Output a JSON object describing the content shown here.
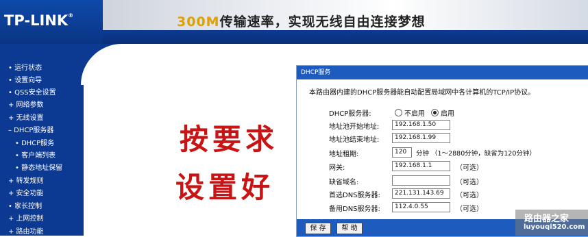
{
  "header": {
    "logo": "TP-LINK",
    "logo_mark": "®",
    "slogan_prefix": "300M",
    "slogan_rest": "传输速率，实现无线自由连接梦想"
  },
  "nav": {
    "items": [
      {
        "label": "• 运行状态"
      },
      {
        "label": "• 设置向导"
      },
      {
        "label": "• QSS安全设置"
      },
      {
        "label": "+ 网络参数"
      },
      {
        "label": "+ 无线设置"
      },
      {
        "label": "– DHCP服务器"
      },
      {
        "label": "• DHCP服务"
      },
      {
        "label": "• 客户端列表"
      },
      {
        "label": "• 静态地址保留"
      },
      {
        "label": "+ 转发规则"
      },
      {
        "label": "+ 安全功能"
      },
      {
        "label": "• 家长控制"
      },
      {
        "label": "+ 上网控制"
      },
      {
        "label": "+ 路由功能"
      }
    ]
  },
  "panel": {
    "title": "DHCP服务",
    "description": "本路由器内建的DHCP服务器能自动配置局域网中各计算机的TCP/IP协议。",
    "dhcp_label": "DHCP服务器:",
    "option_off": "不启用",
    "option_on": "启用",
    "selected": "启用",
    "start_label": "地址池开始地址:",
    "start_value": "192.168.1.50",
    "end_label": "地址池结束地址:",
    "end_value": "192.168.1.99",
    "lease_label": "地址租期:",
    "lease_value": "120",
    "lease_hint": "分钟 （1～2880分钟，缺省为120分钟）",
    "gateway_label": "网关:",
    "gateway_value": "192.168.1.1",
    "domain_label": "缺省域名:",
    "domain_value": "",
    "dns1_label": "首选DNS服务器:",
    "dns1_value": "221.131.143.69",
    "dns2_label": "备用DNS服务器:",
    "dns2_value": "112.4.0.55",
    "optional": "（可选）",
    "save": "保 存",
    "help": "帮 助"
  },
  "annotation": {
    "line1": "按要求",
    "line2": "设置好",
    "color": "#c81414"
  },
  "watermark": {
    "line1": "路由器之家",
    "line2": "luyouqi520.com"
  }
}
